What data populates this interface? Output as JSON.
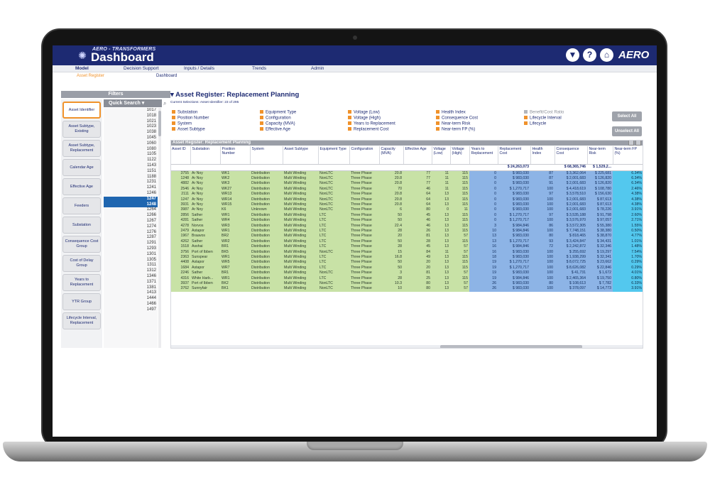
{
  "header": {
    "subtitle": "AERO - TRANSFORMERS",
    "title": "Dashboard",
    "brand": "AERO",
    "icons": [
      "filter-icon",
      "help-icon",
      "home-icon"
    ]
  },
  "menu": {
    "items": [
      "Model",
      "Decision Support",
      "Inputs / Details",
      "Trends",
      "Admin"
    ],
    "sub_items": [
      "Asset Register",
      "Dashboard"
    ]
  },
  "filters": {
    "title": "Filters",
    "buttons": [
      "Asset Identifier",
      "Asset Subtype, Existing",
      "Asset Subtype, Replacement",
      "Calendar Age",
      "Effective Age",
      "Feeders",
      "Substation",
      "Consequence Cost Group",
      "Cost of Delay Group",
      "Years to Replacement",
      "YTR Group",
      "Lifecycle Interval, Replacement"
    ],
    "quick_search": "Quick Search",
    "values": [
      "1017",
      "1018",
      "1021",
      "1023",
      "1038",
      "1045",
      "1060",
      "1080",
      "1105",
      "1122",
      "1143",
      "1151",
      "1188",
      "1231",
      "1241",
      "1246",
      "1247",
      "1248",
      "1264",
      "1266",
      "1267",
      "1274",
      "1276",
      "1287",
      "1291",
      "1293",
      "1301",
      "1305",
      "1311",
      "1312",
      "1346",
      "1371",
      "1381",
      "1413",
      "1444",
      "1466",
      "1497"
    ],
    "selected": [
      "1247",
      "1248"
    ]
  },
  "main": {
    "title": "Asset Register: Replacement Planning",
    "current_selection": "Current Selections: Asset Identifier: 23 of 295",
    "legend": [
      [
        "Substation",
        "Equipment Type",
        "Voltage (Low)",
        "Health Index",
        "Benefit/Cost Ratio"
      ],
      [
        "Position Number",
        "Configuration",
        "Voltage (High)",
        "Consequence Cost",
        "Lifecycle Interval"
      ],
      [
        "System",
        "Capacity (MVA)",
        "Years to Replacement",
        "Near-term Risk",
        "Lifecycle"
      ],
      [
        "Asset Subtype",
        "Effective Age",
        "Replacement Cost",
        "Near-term FP (%)",
        ""
      ]
    ],
    "select_all": "Select All",
    "unselect_all": "Unselect All",
    "table_title": "Asset Register: Replacement Planning"
  },
  "table": {
    "columns": [
      "Asset ID",
      "Substation",
      "Position Number",
      "System",
      "Asset Subtype",
      "Equipment Type",
      "Configuration",
      "Capacity (MVA)",
      "Effective Age",
      "Voltage (Low)",
      "Voltage (High)",
      "Years to Replacement",
      "Replacement Cost",
      "Health Index",
      "Consequence Cost",
      "Near-term Risk",
      "Near-term FP (%)"
    ],
    "totals": [
      "",
      "",
      "",
      "",
      "",
      "",
      "",
      "",
      "",
      "",
      "",
      "",
      "$ 24,263,073",
      "",
      "$ 68,365,746",
      "$ 1,529,2...",
      ""
    ],
    "rows": [
      [
        "3755",
        "Ar Noy",
        "WK1",
        "Distribution",
        "Multi Winding",
        "NonLTC",
        "Three Phase",
        "20.8",
        "77",
        "11",
        "115",
        "0",
        "$ 983,030",
        "87",
        "$ 3,362,064",
        "$ 225,681",
        "6.34%"
      ],
      [
        "1248",
        "Ar Noy",
        "WK2",
        "Distribution",
        "Multi Winding",
        "NonLTC",
        "Three Phase",
        "20.8",
        "77",
        "11",
        "115",
        "0",
        "$ 983,030",
        "87",
        "$ 2,001,683",
        "$ 126,820",
        "6.34%"
      ],
      [
        "4882",
        "Ar Noy",
        "WK3",
        "Distribution",
        "Multi Winding",
        "NonLTC",
        "Three Phase",
        "20.8",
        "77",
        "11",
        "115",
        "0",
        "$ 983,030",
        "91",
        "$ 2,001,683",
        "$ 126,820",
        "6.34%"
      ],
      [
        "2546",
        "Ar Noy",
        "WK27",
        "Distribution",
        "Multi Winding",
        "NonLTC",
        "Three Phase",
        "70",
        "46",
        "11",
        "115",
        "0",
        "$ 1,270,717",
        "100",
        "$ 4,418,619",
        "$ 108,780",
        "2.46%"
      ],
      [
        "2111",
        "Ar Noy",
        "WR13",
        "Distribution",
        "Multi Winding",
        "NonLTC",
        "Three Phase",
        "20.8",
        "64",
        "13",
        "115",
        "0",
        "$ 983,030",
        "97",
        "$ 3,578,510",
        "$ 156,630",
        "4.38%"
      ],
      [
        "1247",
        "Ar Noy",
        "WR14",
        "Distribution",
        "Multi Winding",
        "NonLTC",
        "Three Phase",
        "20.8",
        "64",
        "13",
        "115",
        "0",
        "$ 983,030",
        "100",
        "$ 2,001,683",
        "$ 87,613",
        "4.38%"
      ],
      [
        "3931",
        "Ar Noy",
        "WR15",
        "Distribution",
        "Multi Winding",
        "NonLTC",
        "Three Phase",
        "20.8",
        "64",
        "13",
        "115",
        "0",
        "$ 983,030",
        "100",
        "$ 2,001,683",
        "$ 87,613",
        "4.38%"
      ],
      [
        "3987",
        "Ar Noy",
        "K6",
        "Unknown",
        "Multi Winding",
        "NonLTC",
        "Three Phase",
        "6",
        "80",
        "0",
        "11",
        "0",
        "$ 983,030",
        "100",
        "$ 2,001,683",
        "$ 78,226",
        "3.91%"
      ],
      [
        "2856",
        "Sather",
        "WR1",
        "Distribution",
        "Multi Winding",
        "LTC",
        "Three Phase",
        "50",
        "45",
        "13",
        "115",
        "0",
        "$ 1,270,717",
        "97",
        "$ 3,535,188",
        "$ 91,798",
        "2.60%"
      ],
      [
        "4281",
        "Sather",
        "WR4",
        "Distribution",
        "Multi Winding",
        "LTC",
        "Three Phase",
        "50",
        "46",
        "13",
        "115",
        "0",
        "$ 1,270,717",
        "100",
        "$ 3,576,970",
        "$ 97,057",
        "2.71%"
      ],
      [
        "4278",
        "Norvos",
        "WR3",
        "Distribution",
        "Multi Winding",
        "LTC",
        "Three Phase",
        "22.4",
        "46",
        "13",
        "115",
        "3",
        "$ 984,846",
        "86",
        "$ 3,572,305",
        "$ 55,380",
        "1.55%"
      ],
      [
        "2479",
        "Astapor",
        "WR1",
        "Distribution",
        "Multi Winding",
        "LTC",
        "Three Phase",
        "28",
        "26",
        "13",
        "115",
        "10",
        "$ 984,846",
        "100",
        "$ 7,748,151",
        "$ 38,380",
        "0.50%"
      ],
      [
        "1967",
        "Braavos",
        "BR2",
        "Distribution",
        "Multi Winding",
        "LTC",
        "Three Phase",
        "20",
        "81",
        "13",
        "57",
        "13",
        "$ 983,030",
        "80",
        "$ 818,465",
        "$ 38,870",
        "4.77%"
      ],
      [
        "4262",
        "Sather",
        "WR2",
        "Distribution",
        "Multi Winding",
        "LTC",
        "Three Phase",
        "50",
        "28",
        "13",
        "115",
        "13",
        "$ 1,270,717",
        "93",
        "$ 3,424,847",
        "$ 34,431",
        "1.01%"
      ],
      [
        "1518",
        "Asshai",
        "BR1",
        "Distribution",
        "Multi Winding",
        "LTC",
        "Three Phase",
        "28",
        "45",
        "13",
        "57",
        "16",
        "$ 984,846",
        "72",
        "$ 2,242,872",
        "$ 32,346",
        "1.48%"
      ],
      [
        "3756",
        "Port of Ibben",
        "BK5",
        "Distribution",
        "Multi Winding",
        "NonLTC",
        "Three Phase",
        "15",
        "84",
        "11",
        "57",
        "16",
        "$ 983,030",
        "100",
        "$ 255,692",
        "$ 19,297",
        "7.54%"
      ],
      [
        "2363",
        "Sunspear",
        "WR1",
        "Distribution",
        "Multi Winding",
        "LTC",
        "Three Phase",
        "16.8",
        "49",
        "13",
        "115",
        "18",
        "$ 983,030",
        "100",
        "$ 1,938,299",
        "$ 32,341",
        "1.70%"
      ],
      [
        "4408",
        "Astapor",
        "WR5",
        "Distribution",
        "Multi Winding",
        "LTC",
        "Three Phase",
        "50",
        "20",
        "13",
        "115",
        "19",
        "$ 1,270,717",
        "100",
        "$ 8,072,725",
        "$ 23,662",
        "0.29%"
      ],
      [
        "1684",
        "Astapor",
        "WR7",
        "Distribution",
        "Multi Winding",
        "LTC",
        "Three Phase",
        "50",
        "20",
        "13",
        "115",
        "19",
        "$ 1,270,717",
        "100",
        "$ 8,626,082",
        "$ 22,846",
        "0.29%"
      ],
      [
        "2246",
        "Sather",
        "BR1",
        "Distribution",
        "Multi Winding",
        "NonLTC",
        "Three Phase",
        "3",
        "81",
        "13",
        "57",
        "19",
        "$ 983,030",
        "100",
        "$ 41,731",
        "$ 1,672",
        "4.01%"
      ],
      [
        "4316",
        "White Harb...",
        "WR1",
        "Distribution",
        "Multi Winding",
        "LTC",
        "Three Phase",
        "28",
        "25",
        "13",
        "115",
        "19",
        "$ 984,846",
        "100",
        "$ 2,465,364",
        "$ 19,750",
        "0.80%"
      ],
      [
        "3937",
        "Port of Ibben",
        "BK2",
        "Distribution",
        "Multi Winding",
        "NonLTC",
        "Three Phase",
        "10.3",
        "80",
        "13",
        "57",
        "26",
        "$ 983,030",
        "80",
        "$ 108,613",
        "$ 7,782",
        "6.33%"
      ],
      [
        "3762",
        "Sunnyfair",
        "BK1",
        "Distribution",
        "Multi Winding",
        "NonLTC",
        "Three Phase",
        "10",
        "80",
        "13",
        "57",
        "26",
        "$ 983,030",
        "100",
        "$ 378,097",
        "$ 14,773",
        "3.91%"
      ]
    ]
  },
  "colors": {
    "header": "#1d2a72",
    "accent": "#f0922b",
    "green": "#c8e2a6",
    "blue": "#8db4e6",
    "cyan": "#53c8ee"
  }
}
